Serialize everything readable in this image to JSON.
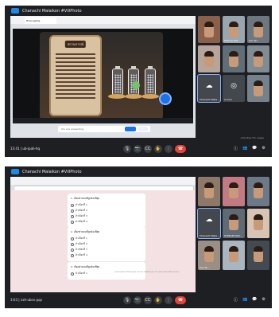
{
  "screenshot1": {
    "header_title": "Chanachi Malaikon #VillPhoto",
    "time_meeting": "13:41 | ub-ipah-hq",
    "game": {
      "scroll_title": "สถานการณ์",
      "browser_tab": "Trivia game"
    },
    "share_banner": "You are presenting",
    "tiles": [
      {
        "type": "video",
        "label": "",
        "bg": "#8b5f4a"
      },
      {
        "type": "video",
        "label": "Trainee Kitt...",
        "bg": "#9aa6ad"
      },
      {
        "type": "video",
        "label": "Pun Ta...",
        "bg": "#6d7780"
      },
      {
        "type": "video",
        "label": "",
        "bg": "#b7a49b"
      },
      {
        "type": "video",
        "label": "",
        "bg": "#5f6e77"
      },
      {
        "type": "video",
        "label": "",
        "bg": "#7f8c94"
      },
      {
        "type": "account",
        "label": "Chanachi Mala...",
        "bg": "#43484e"
      },
      {
        "type": "account",
        "label": "A Com",
        "bg": "#43484e"
      },
      {
        "type": "video",
        "label": "",
        "bg": "#75828b"
      }
    ],
    "controls": [
      "🎙",
      "📷",
      "CC",
      "✋",
      "⋮",
      "☎"
    ],
    "right_icons": [
      "ⓘ",
      "👥",
      "💬",
      "⚙"
    ],
    "note": "Activities 5% usage"
  },
  "screenshot2": {
    "header_title": "Chanachi Malaikon #VillPhoto",
    "time_meeting": "3:03 | nzh-ubsn-pqz",
    "form": {
      "questions": [
        {
          "title": "1. เลือกคำตอบที่ถูกต้องที่สุด",
          "options": [
            "ตัวเลือกที่ 1",
            "ตัวเลือกที่ 2",
            "ตัวเลือกที่ 3",
            "ตัวเลือกที่ 4"
          ]
        },
        {
          "title": "2. เลือกคำตอบที่ถูกต้องที่สุด",
          "options": [
            "ตัวเลือกที่ 1",
            "ตัวเลือกที่ 2",
            "ตัวเลือกที่ 3",
            "ตัวเลือกที่ 4"
          ]
        },
        {
          "title": "3. เลือกคำตอบที่ถูกต้องที่สุด",
          "options": [
            "ตัวเลือกที่ 1"
          ]
        }
      ]
    },
    "tiles": [
      {
        "type": "video",
        "label": "",
        "bg": "#8d7869"
      },
      {
        "type": "video",
        "label": "",
        "bg": "#c47a82"
      },
      {
        "type": "video",
        "label": "",
        "bg": "#6c7a88"
      },
      {
        "type": "account",
        "label": "Chanachi Mala...",
        "bg": "#43484e"
      },
      {
        "type": "video",
        "label": "STREAM KOD...",
        "bg": "#5e6a74"
      },
      {
        "type": "video",
        "label": "",
        "bg": "#d7c4b4"
      },
      {
        "type": "video",
        "label": "Pun Ta...",
        "bg": "#9a8e85"
      },
      {
        "type": "video",
        "label": "",
        "bg": "#a9b6bf"
      },
      {
        "type": "video",
        "label": "",
        "bg": "#444b50"
      }
    ],
    "controls": [
      "🎙",
      "📷",
      "CC",
      "✋",
      "⋮",
      "☎"
    ],
    "right_icons": [
      "ⓘ",
      "👥",
      "💬",
      "⚙"
    ],
    "watermark": "Activate Windows\nGo to Settings to activate Windows."
  }
}
